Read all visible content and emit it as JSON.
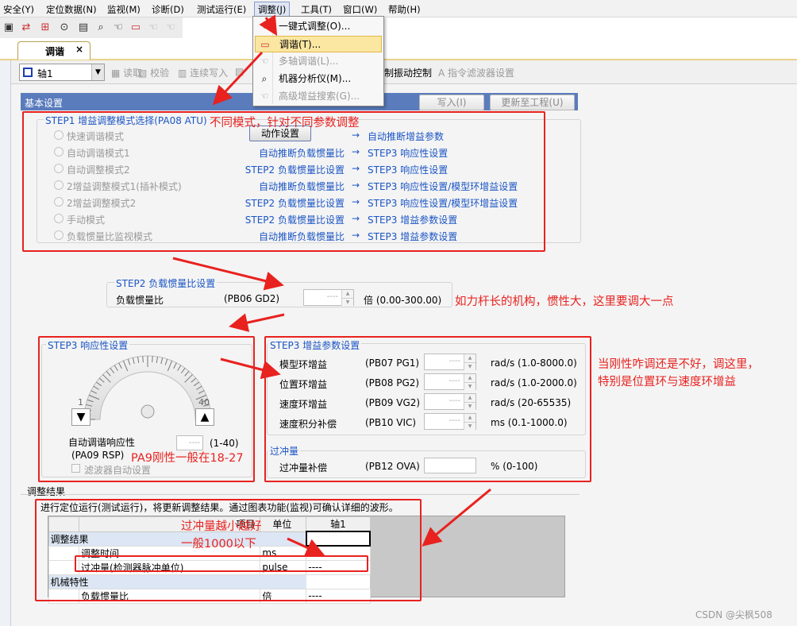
{
  "menu": {
    "items": [
      "安全(Y)",
      "定位数据(N)",
      "监视(M)",
      "诊断(D)",
      "测试运行(E)",
      "调整(J)",
      "工具(T)",
      "窗口(W)",
      "帮助(H)"
    ]
  },
  "toolbar": {
    "icons": [
      "save-icon",
      "swap-icon",
      "link-icon",
      "watch-icon",
      "sheet-icon",
      "zoom-icon",
      "hand-icon",
      "tune-icon",
      "hand2-icon",
      "hand3-icon"
    ]
  },
  "tab": {
    "label": "调谐",
    "close": "×"
  },
  "subtoolbar": {
    "axis": "轴1",
    "read": "读取",
    "verify": "校验",
    "write_cont": "连续写入",
    "vib_ctrl": "制振动控制",
    "cmd_filter": "指令滤波器设置"
  },
  "dropdown": {
    "items": [
      {
        "label": "一键式调整(O)...",
        "enabled": true
      },
      {
        "label": "调谐(T)...",
        "enabled": true,
        "highlighted": true
      },
      {
        "label": "多轴调谐(L)...",
        "enabled": false
      },
      {
        "label": "机器分析仪(M)...",
        "enabled": true
      },
      {
        "label": "高级增益搜索(G)...",
        "enabled": false
      }
    ]
  },
  "basic": {
    "title": "基本设置",
    "write_button": "写入(I)",
    "update_button": "更新至工程(U)"
  },
  "step1": {
    "title": "STEP1 增益调整模式选择(PA08 ATU)",
    "action_button": "动作设置",
    "modes": [
      {
        "label": "快速调谐模式",
        "middle": "",
        "right": "自动推断增益参数"
      },
      {
        "label": "自动调谐模式1",
        "middle": "自动推断负载惯量比",
        "right": "STEP3 响应性设置"
      },
      {
        "label": "自动调整模式2",
        "middle": "STEP2 负载惯量比设置",
        "right": "STEP3 响应性设置"
      },
      {
        "label": "2增益调整模式1(插补模式)",
        "middle": "自动推断负载惯量比",
        "right": "STEP3 响应性设置/模型环增益设置"
      },
      {
        "label": "2增益调整模式2",
        "middle": "STEP2 负载惯量比设置",
        "right": "STEP3 响应性设置/模型环增益设置"
      },
      {
        "label": "手动模式",
        "middle": "STEP2 负载惯量比设置",
        "right": "STEP3 增益参数设置"
      },
      {
        "label": "负载惯量比监视模式",
        "middle": "自动推断负载惯量比",
        "right": "STEP3 增益参数设置"
      }
    ],
    "arrow": "→"
  },
  "step2": {
    "title": "STEP2 负载惯量比设置",
    "param_label": "负载惯量比",
    "param_code": "(PB06 GD2)",
    "value": "----",
    "range": "倍 (0.00-300.00)"
  },
  "step3_resp": {
    "title": "STEP3 响应性设置",
    "min": "1",
    "max": "40",
    "label": "自动调谐响应性",
    "code": "(PA09 RSP)",
    "value": "----",
    "range": "(1-40)",
    "filter_auto": "滤波器自动设置"
  },
  "step3_gain": {
    "title": "STEP3 增益参数设置",
    "params": [
      {
        "label": "模型环增益",
        "code": "(PB07 PG1)",
        "value": "----",
        "range": "rad/s (1.0-8000.0)"
      },
      {
        "label": "位置环增益",
        "code": "(PB08 PG2)",
        "value": "----",
        "range": "rad/s (1.0-2000.0)"
      },
      {
        "label": "速度环增益",
        "code": "(PB09 VG2)",
        "value": "----",
        "range": "rad/s (20-65535)"
      },
      {
        "label": "速度积分补偿",
        "code": "(PB10 VIC)",
        "value": "----",
        "range": "ms (0.1-1000.0)"
      }
    ],
    "overshoot_title": "过冲量",
    "overshoot": {
      "label": "过冲量补偿",
      "code": "(PB12 OVA)",
      "value": "",
      "range": "% (0-100)"
    }
  },
  "results": {
    "title": "调整结果",
    "note": "进行定位运行(测试运行)，将更新调整结果。通过图表功能(监视)可确认详细的波形。",
    "header": {
      "item": "项目",
      "unit": "单位",
      "axis": "轴1"
    },
    "group1": "调整结果",
    "rows1": [
      {
        "item": "调整时间",
        "unit": "ms",
        "value": "----"
      },
      {
        "item": "过冲量(检测器脉冲单位)",
        "unit": "pulse",
        "value": "----"
      }
    ],
    "group2": "机械特性",
    "rows2": [
      {
        "item": "负载惯量比",
        "unit": "倍",
        "value": "----"
      }
    ]
  },
  "annotations": {
    "a1": "不同模式，针对不同参数调整",
    "a2": "如力杆长的机构，惯性大，这里要调大一点",
    "a3": "PA9刚性一般在18-27",
    "a4_line1": "当刚性咋调还是不好，调这里，",
    "a4_line2": "特别是位置环与速度环增益",
    "a5_line1": "过冲量越小越好",
    "a5_line2": "一般1000以下"
  },
  "watermark": "CSDN @尖枫508",
  "colors": {
    "annotation_red": "#e8221f",
    "label_blue": "#1b55c4",
    "highlight": "#fbe7a2"
  }
}
